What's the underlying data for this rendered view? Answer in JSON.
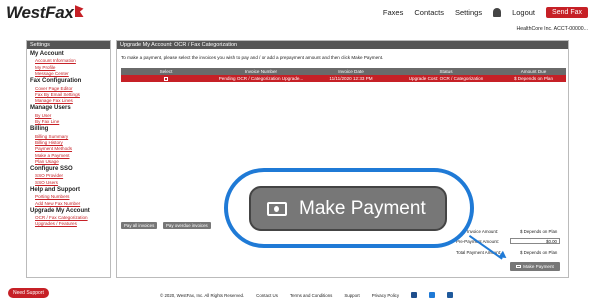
{
  "header": {
    "logo": "WestFax",
    "nav": [
      "Faxes",
      "Contacts",
      "Settings"
    ],
    "logout": "Logout",
    "send_fax": "Send Fax",
    "account": "HealthCore Inc. ACCT-00000..."
  },
  "sidebar": {
    "title": "Settings",
    "groups": [
      {
        "label": "My Account",
        "items": [
          "Account Information",
          "My Profile",
          "Message Center"
        ]
      },
      {
        "label": "Fax Configuration",
        "items": [
          "Cover Page Editor",
          "Fax By Email Settings",
          "Manage Fax Lines"
        ]
      },
      {
        "label": "Manage Users",
        "items": [
          "By User",
          "By Fax Line"
        ]
      },
      {
        "label": "Billing",
        "items": [
          "Billing Summary",
          "Billing History",
          "Payment Methods",
          "Make a Payment",
          "Plan Usage"
        ]
      },
      {
        "label": "Configure SSO",
        "items": [
          "SSO Provider",
          "SSO Users"
        ]
      },
      {
        "label": "Help and Support",
        "items": [
          "Porting Numbers",
          "Add New Fax Number"
        ]
      },
      {
        "label": "Upgrade My Account",
        "items": [
          "OCR / Fax Categorization",
          "Upgrades / Features"
        ]
      }
    ]
  },
  "main": {
    "title": "Upgrade My Account:  OCR / Fax Categorization",
    "instructions": "To make a payment, please select the invoices you wish to pay and / or add a prepayment amount and then click Make Payment.",
    "table": {
      "headers": [
        "Select",
        "Invoice Number",
        "Invoice Date",
        "Status",
        "Amount Due"
      ],
      "rows": [
        [
          "",
          "Pending OCR / Categorization Upgrade...",
          "11/11/2020 12:33 PM",
          "Upgrade Cost: OCR / Categorization",
          "$ Depends on Plan"
        ]
      ]
    },
    "pay_all": "Pay all invoices",
    "pay_overdue": "Pay overdue invoices",
    "summary": {
      "invoice_amount_label": "Invoice Amount:",
      "invoice_amount": "$ Depends on Plan",
      "prepayment_label": "Pre-Payment Amount:",
      "prepayment_value": "$0.00",
      "total_label": "Total Payment Amount:",
      "total_value": "$ Depends on Plan"
    },
    "make_payment_small": "Make Payment"
  },
  "callout": {
    "label": "Make Payment",
    "ring_color": "#1f7ad6"
  },
  "footer": {
    "support": "Need Support",
    "copyright": "© 2020, WestFax, Inc. All Rights Reserved.",
    "links": [
      "Contact Us",
      "Terms and Conditions",
      "Support",
      "Privacy Policy"
    ]
  }
}
